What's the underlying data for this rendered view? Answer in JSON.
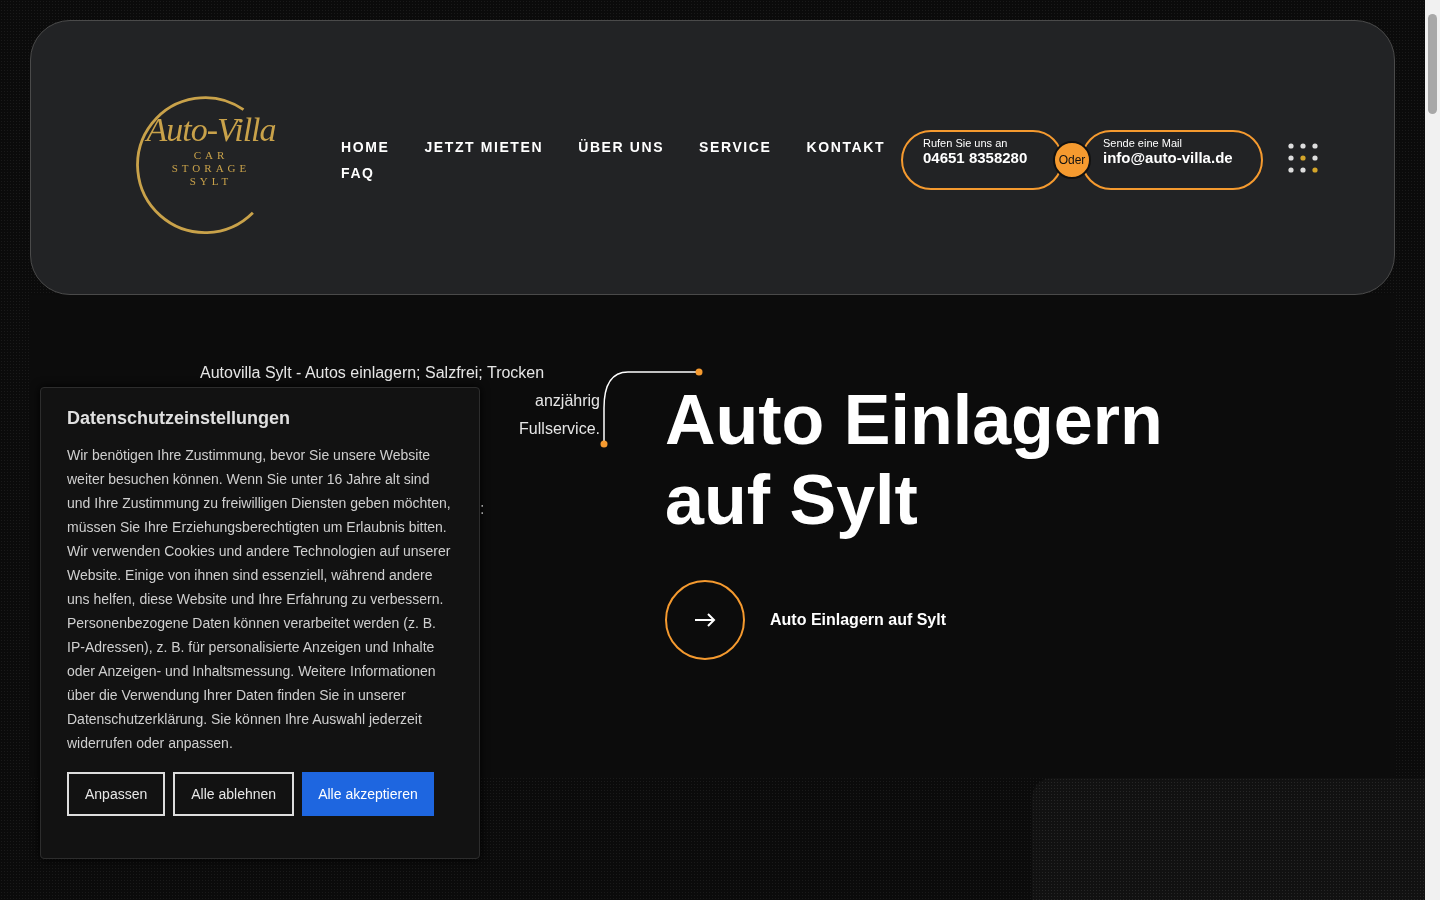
{
  "logo": {
    "script": "Auto-Villa",
    "lines": [
      "CAR",
      "STORAGE",
      "SYLT"
    ]
  },
  "nav": [
    {
      "label": "HOME"
    },
    {
      "label": "JETZT MIETEN"
    },
    {
      "label": "ÜBER UNS"
    },
    {
      "label": "SERVICE"
    },
    {
      "label": "KONTAKT"
    },
    {
      "label": "FAQ"
    }
  ],
  "contacts": [
    {
      "caption": "Rufen Sie uns an",
      "value": "04651 8358280"
    },
    {
      "caption": "Sende eine Mail",
      "value": "info@auto-villa.de"
    }
  ],
  "contact_separator": "Oder",
  "intro_lines": [
    "Autovilla Sylt - Autos einlagern; Salzfrei; Trocken",
    "anzjährig",
    "Fullservice.",
    ":"
  ],
  "hero": {
    "title": "Auto Einlagern auf Sylt",
    "cta": "Auto Einlagern auf Sylt"
  },
  "consent": {
    "title": "Datenschutzeinstellungen",
    "text": "Wir benötigen Ihre Zustimmung, bevor Sie unsere Website weiter besuchen können. Wenn Sie unter 16 Jahre alt sind und Ihre Zustimmung zu freiwilligen Diensten geben möchten, müssen Sie Ihre Erziehungsberechtigten um Erlaubnis bitten. Wir verwenden Cookies und andere Technologien auf unserer Website. Einige von ihnen sind essenziell, während andere uns helfen, diese Website und Ihre Erfahrung zu verbessern. Personenbezogene Daten können verarbeitet werden (z. B. IP-Adressen), z. B. für personalisierte Anzeigen und Inhalte oder Anzeigen- und Inhaltsmessung. Weitere Informationen über die Verwendung Ihrer Daten finden Sie in unserer Datenschutzerklärung. Sie können Ihre Auswahl jederzeit widerrufen oder anpassen.",
    "buttons": [
      {
        "label": "Anpassen",
        "kind": "outline"
      },
      {
        "label": "Alle ablehnen",
        "kind": "outline"
      },
      {
        "label": "Alle akzeptieren",
        "kind": "primary"
      }
    ]
  }
}
